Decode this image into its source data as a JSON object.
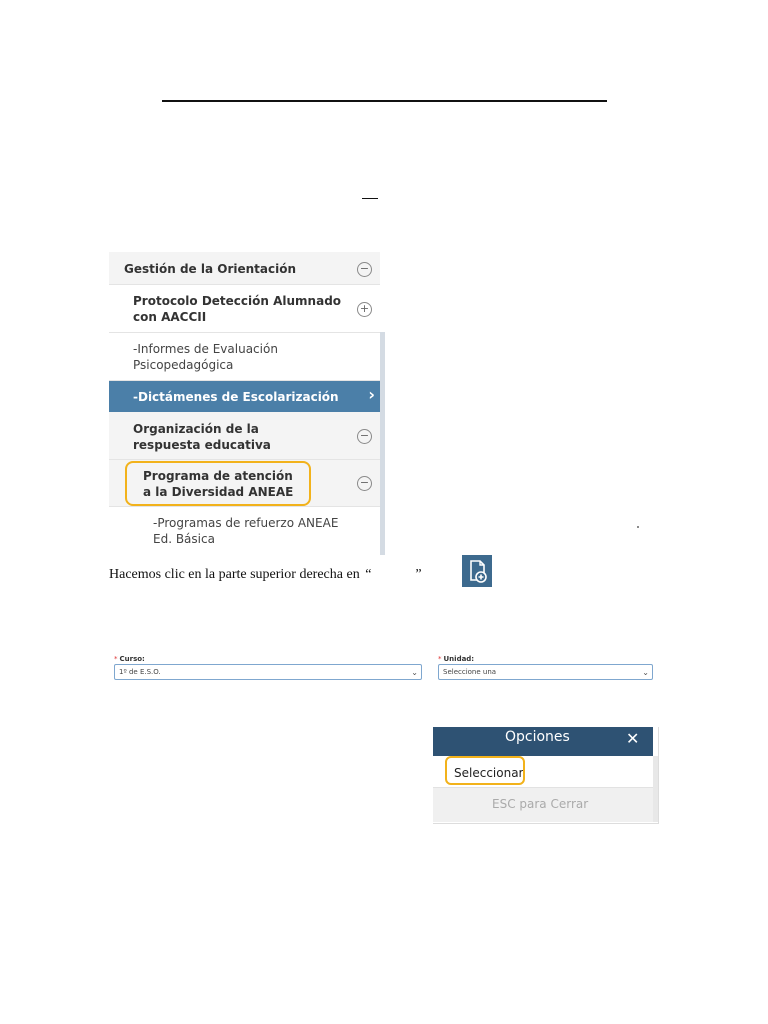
{
  "menu": {
    "group_title": "Gestión de la Orientación",
    "protocolo": "Protocolo Detección Alumnado con AACCII",
    "informes": "-Informes de Evaluación Psicopedagógica",
    "dictamenes": "-Dictámenes de Escolarización",
    "organizacion": "Organización de la respuesta educativa",
    "programa": "Programa de atención a la Diversidad ANEAE",
    "refuerzo": "-Programas de refuerzo ANEAE Ed. Básica",
    "minus_symbol": "−",
    "plus_symbol": "+",
    "chevron_symbol": "›"
  },
  "instruction": {
    "text": "Hacemos clic en la parte superior derecha en",
    "open_quote": "“",
    "close_quote": "”"
  },
  "form": {
    "curso_label": "Curso:",
    "curso_value": "1º de E.S.O.",
    "unidad_label": "Unidad:",
    "unidad_value": "Seleccione una",
    "required_mark": "*",
    "arrow": "⌄"
  },
  "dialog": {
    "title": "Opciones",
    "close_symbol": "✕",
    "select_label": "Seleccionar",
    "footer": "ESC para Cerrar"
  },
  "colors": {
    "active_row": "#4b7fa8",
    "dialog_header": "#2e5273",
    "highlight": "#f2b21b",
    "doc_icon_bg": "#3d6a8e"
  },
  "icons": {
    "add_document": "document-add-icon"
  }
}
